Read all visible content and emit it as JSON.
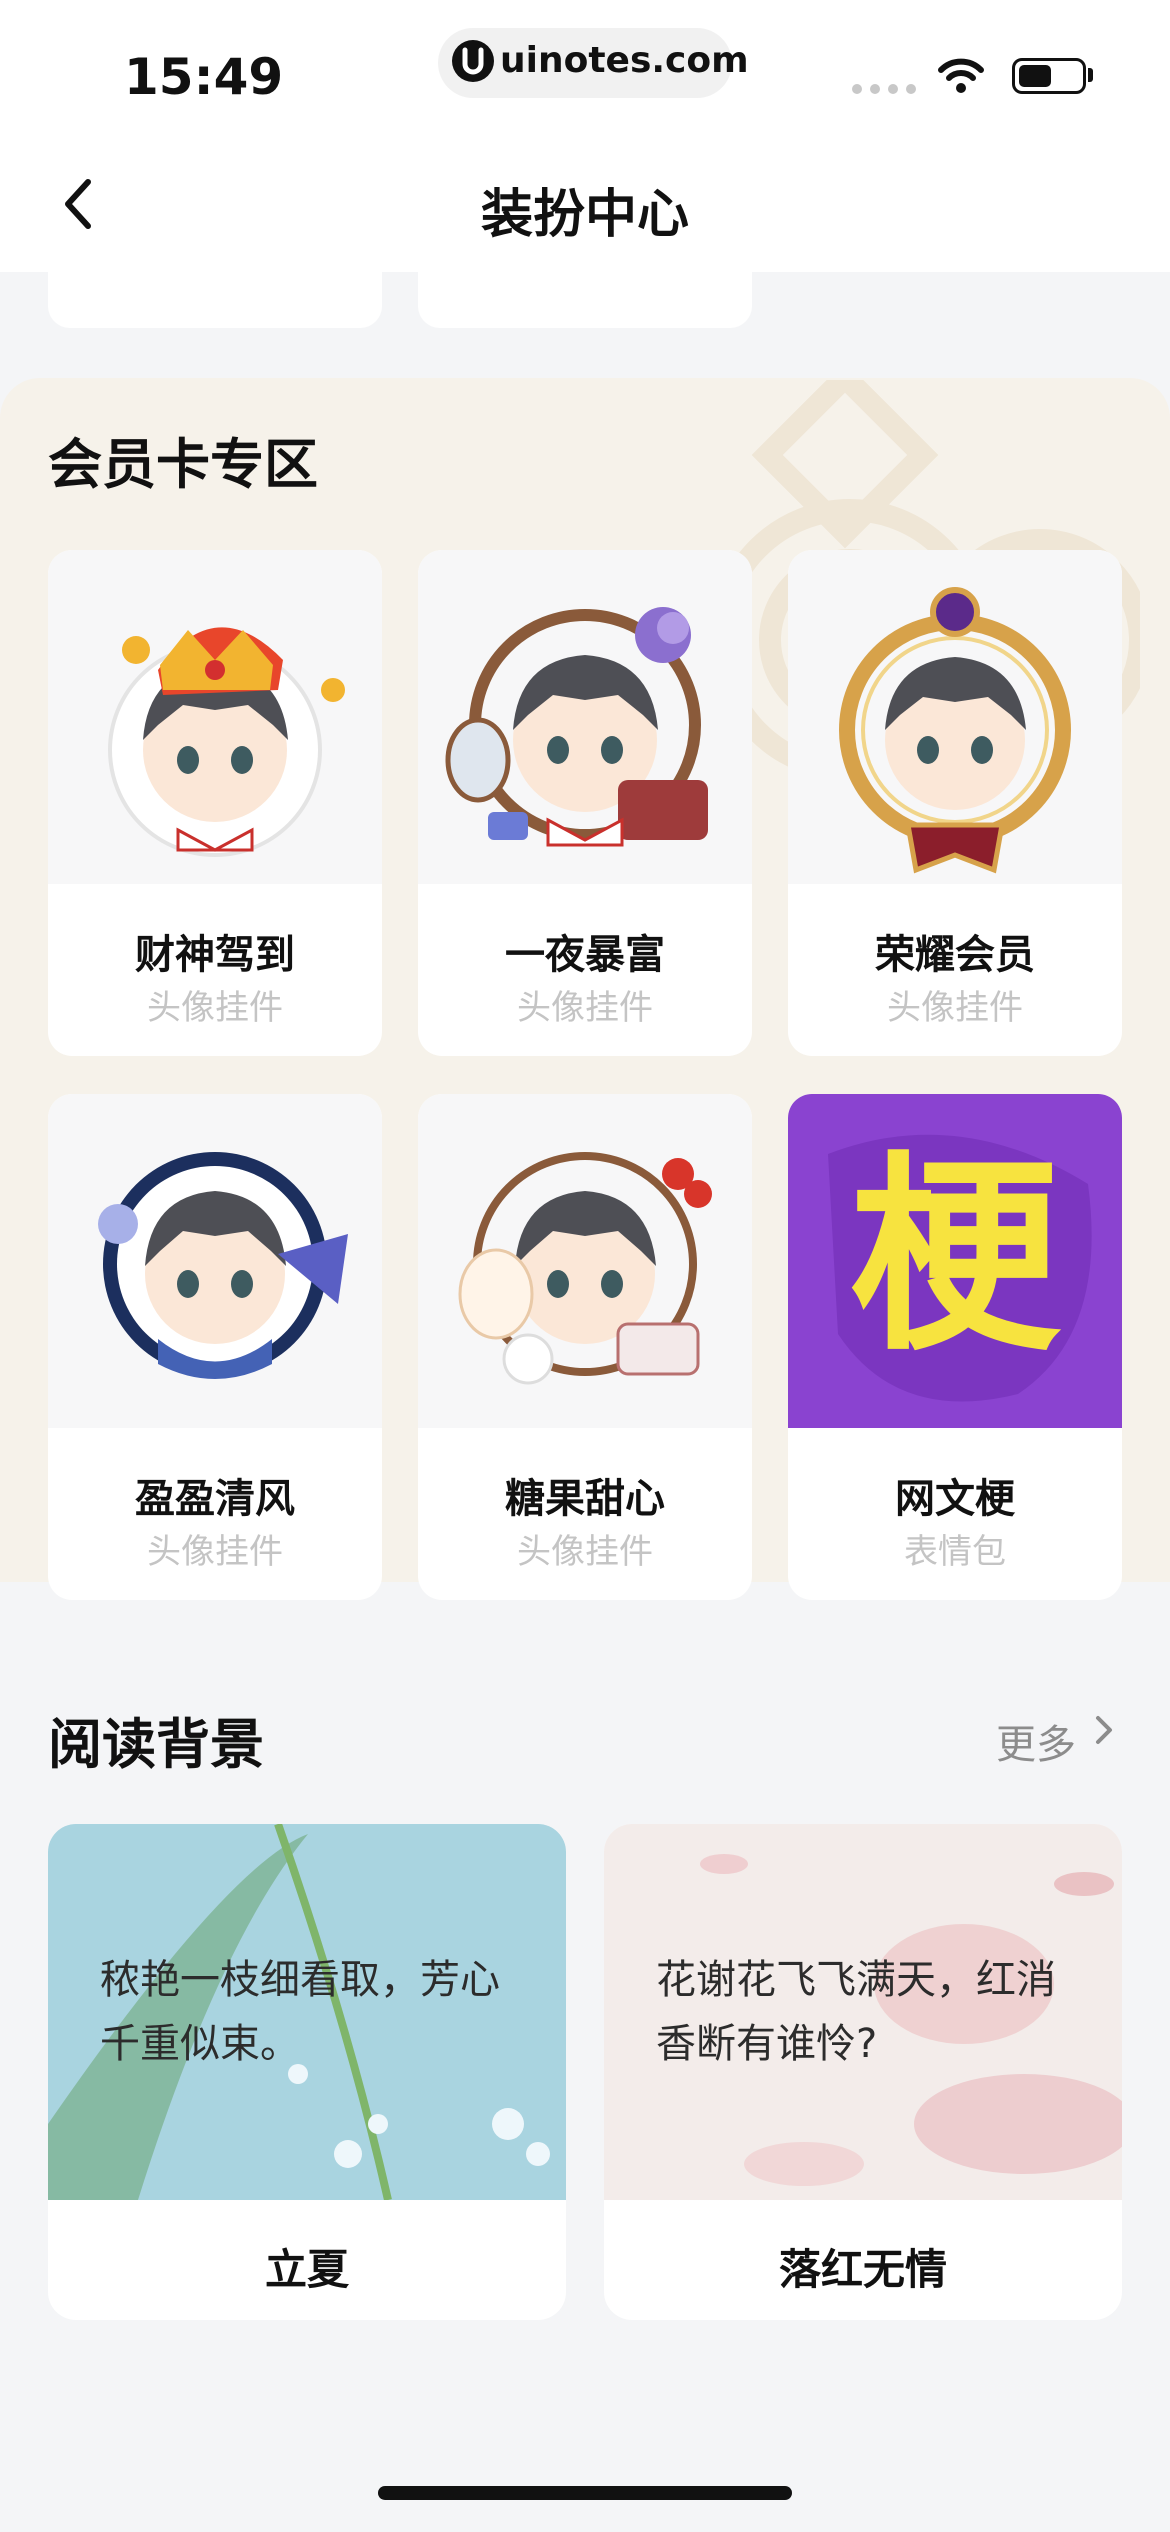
{
  "status_bar": {
    "time": "15:49",
    "url": "uinotes.com"
  },
  "nav": {
    "title": "装扮中心",
    "back_icon": "chevron-left-icon"
  },
  "member_section": {
    "title": "会员卡专区",
    "items": [
      {
        "name": "财神驾到",
        "type": "头像挂件"
      },
      {
        "name": "一夜暴富",
        "type": "头像挂件"
      },
      {
        "name": "荣耀会员",
        "type": "头像挂件"
      },
      {
        "name": "盈盈清风",
        "type": "头像挂件"
      },
      {
        "name": "糖果甜心",
        "type": "头像挂件"
      },
      {
        "name": "网文梗",
        "type": "表情包",
        "glyph": "梗"
      }
    ]
  },
  "reading_section": {
    "title": "阅读背景",
    "more_label": "更多",
    "items": [
      {
        "name": "立夏",
        "poem": "秾艳一枝细看取，芳心千重似束。"
      },
      {
        "name": "落红无情",
        "poem": "花谢花飞飞满天，红消香断有谁怜?"
      }
    ]
  },
  "colors": {
    "accent_purple": "#8a43d0",
    "glyph_yellow": "#f7e33f",
    "member_bg": "#f6f2ea",
    "page_bg": "#f4f5f7"
  }
}
